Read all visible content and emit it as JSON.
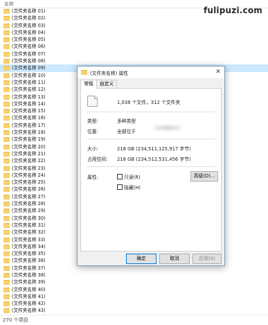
{
  "column_header": "名称",
  "watermark": "fulipuzi.com",
  "files": [
    "(文件夹名称 01)",
    "(文件夹名称 02)",
    "(文件夹名称 03)",
    "(文件夹名称 04)",
    "(文件夹名称 05)",
    "(文件夹名称 06)",
    "(文件夹名称 07)",
    "(文件夹名称 08)",
    "(文件夹名称 09)",
    "(文件夹名称 10)",
    "(文件夹名称 11)",
    "(文件夹名称 12)",
    "(文件夹名称 13)",
    "(文件夹名称 14)",
    "(文件夹名称 15)",
    "(文件夹名称 16)",
    "(文件夹名称 17)",
    "(文件夹名称 18)",
    "(文件夹名称 19)",
    "(文件夹名称 20)",
    "(文件夹名称 21)",
    "(文件夹名称 22)",
    "(文件夹名称 23)",
    "(文件夹名称 24)",
    "(文件夹名称 25)",
    "(文件夹名称 26)",
    "(文件夹名称 27)",
    "(文件夹名称 28)",
    "(文件夹名称 29)",
    "(文件夹名称 30)",
    "(文件夹名称 31)",
    "(文件夹名称 32)",
    "(文件夹名称 33)",
    "(文件夹名称 34)",
    "(文件夹名称 35)",
    "(文件夹名称 36)",
    "(文件夹名称 37)",
    "(文件夹名称 38)",
    "(文件夹名称 39)",
    "(文件夹名称 40)",
    "(文件夹名称 41)",
    "(文件夹名称 42)",
    "(文件夹名称 43)"
  ],
  "status_bar": "270 个项目",
  "dialog": {
    "title": "(文件夹名称) 属性",
    "tabs": [
      "常规",
      "自定义"
    ],
    "counts": "1,038 个文件，312 个文件夹",
    "type_label": "类型:",
    "type_value": "多种类型",
    "location_label": "位置:",
    "location_value": "全部位于",
    "size_label": "大小:",
    "size_value": "218 GB (234,511,125,917 字节)",
    "disk_label": "占用空间:",
    "disk_value": "218 GB (234,512,531,456 字节)",
    "attr_label": "属性:",
    "readonly_label": "只读(R)",
    "hidden_label": "隐藏(H)",
    "advanced_button": "高级(D)...",
    "ok_button": "确定",
    "cancel_button": "取消",
    "apply_button": "应用(A)"
  }
}
